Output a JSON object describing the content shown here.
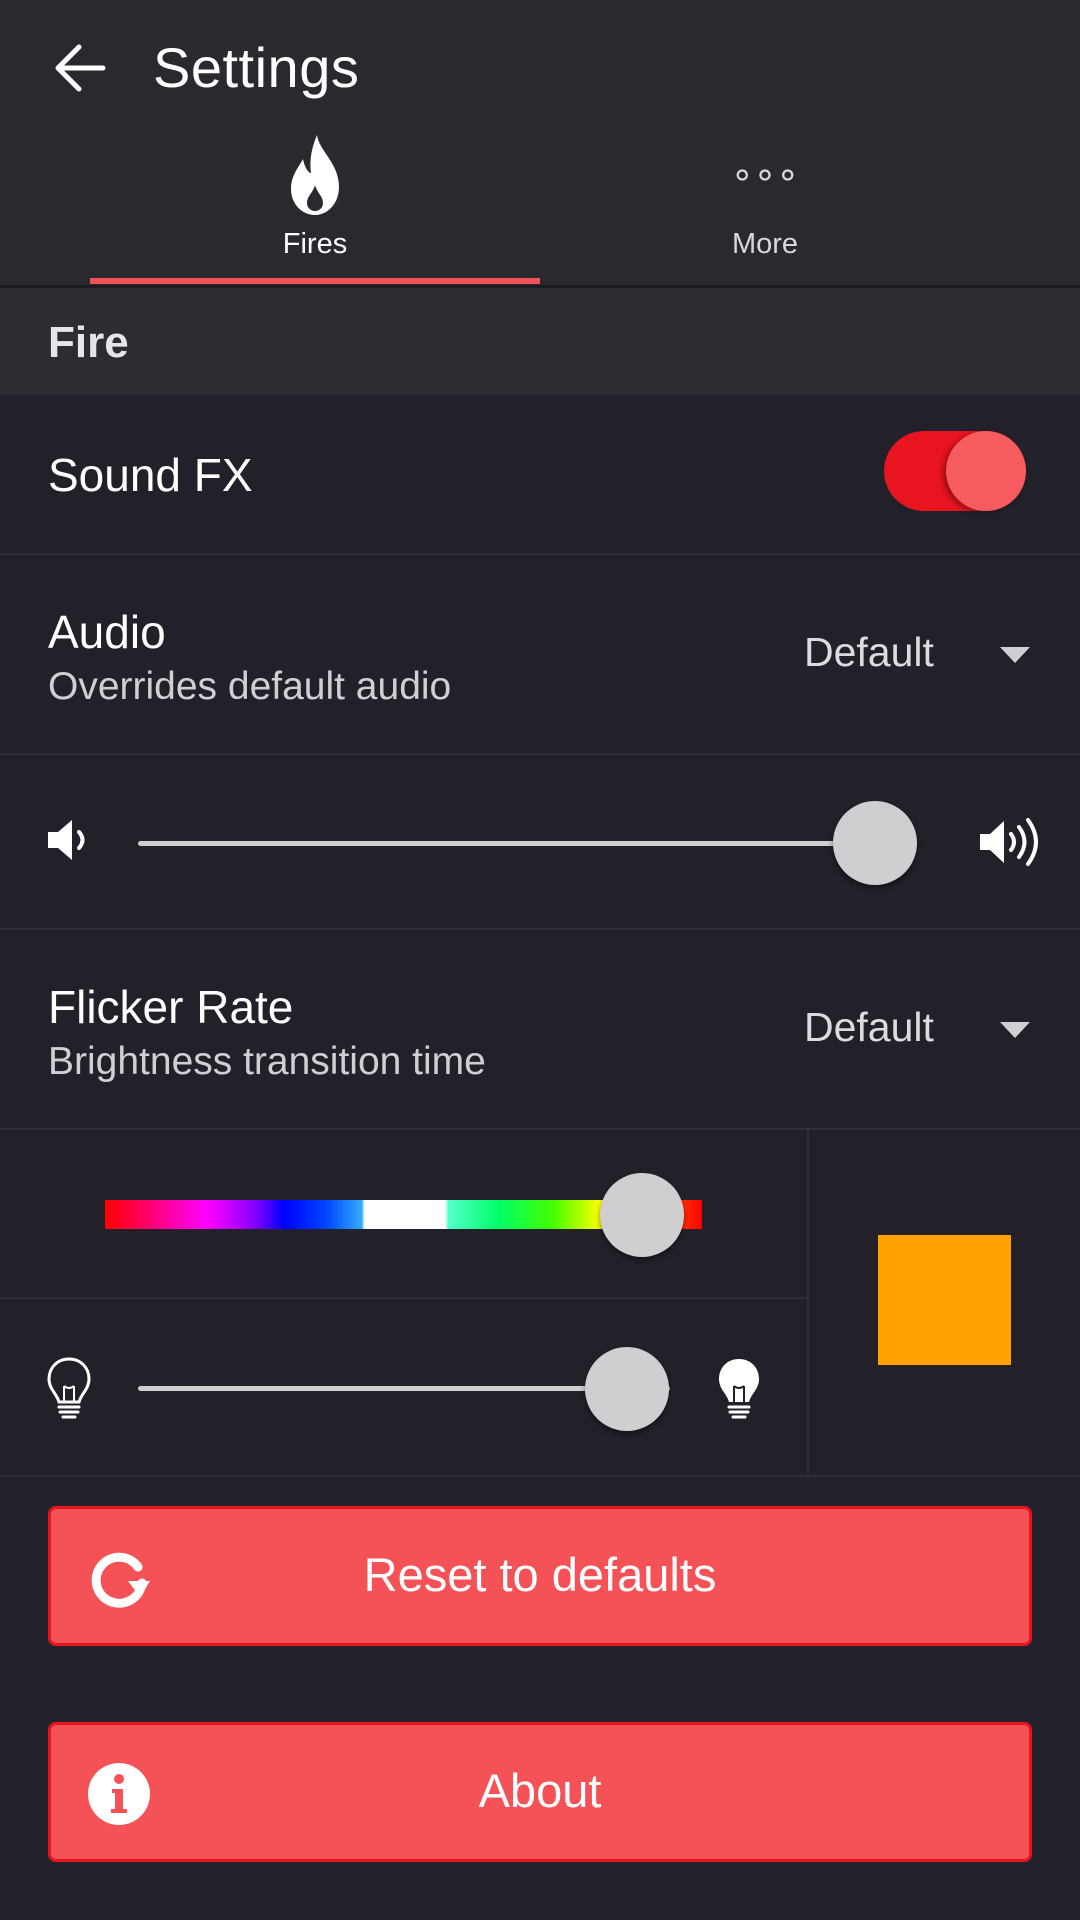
{
  "header": {
    "title": "Settings",
    "back_icon": "arrow-left-icon"
  },
  "tabs": [
    {
      "label": "Fires",
      "icon": "flame-icon",
      "active": true
    },
    {
      "label": "More",
      "icon": "more-horizontal-icon",
      "active": false
    }
  ],
  "section": {
    "title": "Fire"
  },
  "sound_fx": {
    "label": "Sound FX",
    "enabled": true
  },
  "audio": {
    "label": "Audio",
    "subtitle": "Overrides default audio",
    "selected": "Default"
  },
  "volume": {
    "min_icon": "volume-low-icon",
    "max_icon": "volume-high-icon",
    "value_fraction": 0.97
  },
  "flicker_rate": {
    "label": "Flicker Rate",
    "subtitle": "Brightness transition time",
    "selected": "Default"
  },
  "color": {
    "hue_fraction": 0.9,
    "swatch_color": "#ffa200"
  },
  "brightness": {
    "min_icon": "bulb-outline-icon",
    "max_icon": "bulb-filled-icon",
    "value_fraction": 0.92
  },
  "buttons": {
    "reset_label": "Reset to defaults",
    "reset_icon": "refresh-icon",
    "about_label": "About",
    "about_icon": "info-icon"
  },
  "colors": {
    "accent": "#f55257",
    "accent_border": "#e8141f",
    "background": "#22212a"
  }
}
